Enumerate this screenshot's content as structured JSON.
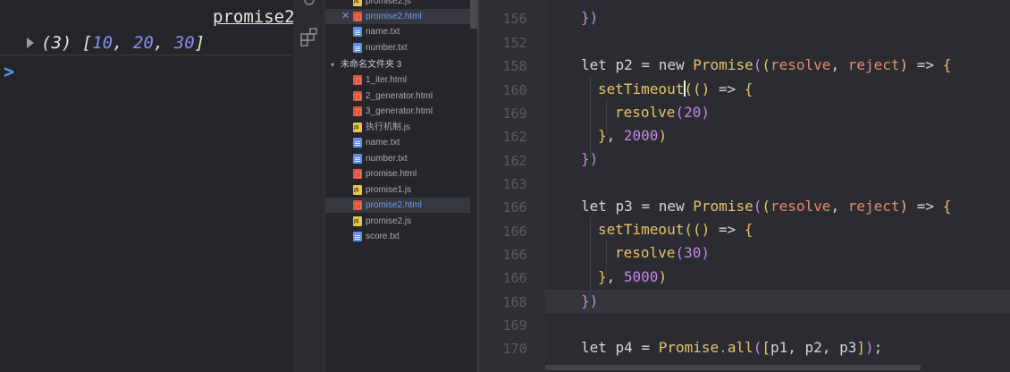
{
  "console": {
    "file_link": "promise2",
    "array_count": "(3)",
    "array_open": "[",
    "array_values": [
      "10",
      "20",
      "30"
    ],
    "array_sep": ", ",
    "array_close": "]",
    "prompt": ">"
  },
  "explorer": {
    "partial_top": "promise2.js",
    "open_files": [
      {
        "name": "promise2.html",
        "type": "html",
        "active": true
      },
      {
        "name": "name.txt",
        "type": "txt"
      },
      {
        "name": "number.txt",
        "type": "txt"
      }
    ],
    "folder_label": "未命名文件夹 3",
    "files": [
      {
        "name": "1_iter.html",
        "type": "html"
      },
      {
        "name": "2_generator.html",
        "type": "html"
      },
      {
        "name": "3_generator.html",
        "type": "html"
      },
      {
        "name": "执行机制.js",
        "type": "js"
      },
      {
        "name": "name.txt",
        "type": "txt"
      },
      {
        "name": "number.txt",
        "type": "txt"
      },
      {
        "name": "promise.html",
        "type": "html"
      },
      {
        "name": "promise1.js",
        "type": "js"
      },
      {
        "name": "promise2.html",
        "type": "html",
        "active": true
      },
      {
        "name": "promise2.js",
        "type": "js"
      },
      {
        "name": "score.txt",
        "type": "txt"
      }
    ]
  },
  "editor": {
    "line_numbers": [
      "156",
      "152",
      "158",
      "160",
      "169",
      "162",
      "162",
      "163",
      "166",
      "166",
      "166",
      "166",
      "168",
      "169",
      "170"
    ],
    "lines": {
      "l156": "})",
      "l158_let": "let",
      "l158_p": "p2",
      "l158_eq": "=",
      "l158_new": "new",
      "l158_cls": "Promise",
      "l158_resolve": "resolve",
      "l158_reject": "reject",
      "l159_fn": "setTimeout",
      "l160_fn": "resolve",
      "l160_num": "20",
      "l161_num": "2000",
      "l162": "})",
      "l164_p": "p3",
      "l165_fn": "setTimeout",
      "l166_fn": "resolve",
      "l166_num": "30",
      "l167_num": "5000",
      "l168": "})",
      "l170_let": "let",
      "l170_p": "p4",
      "l170_cls": "Promise",
      "l170_method": "all",
      "l170_args": "p1, p2, p3"
    }
  }
}
